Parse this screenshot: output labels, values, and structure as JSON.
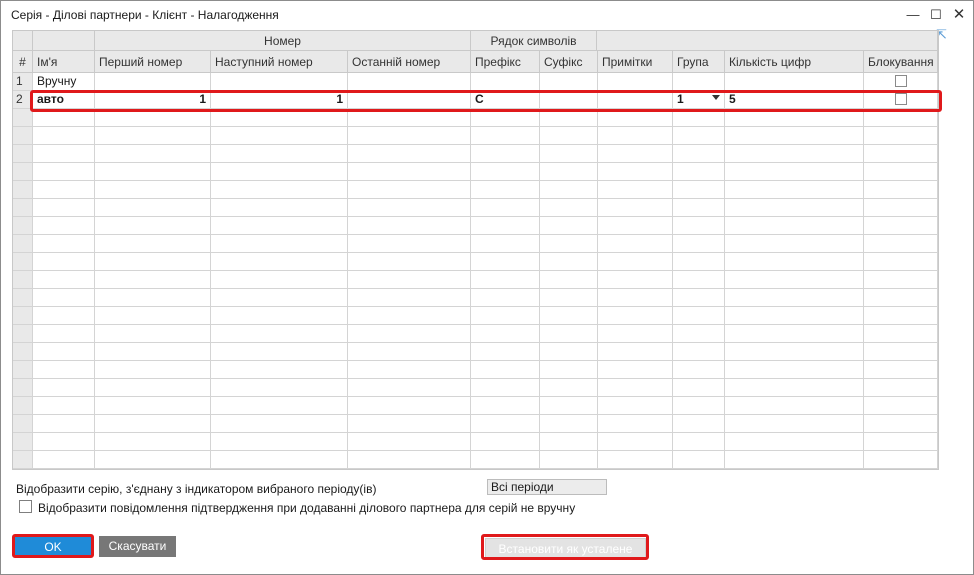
{
  "window": {
    "title": "Серія - Ділові партнери - Клієнт - Налагодження",
    "minimize": "—",
    "maximize": "☐",
    "close": "✕",
    "resize_icon": "⇱"
  },
  "grid": {
    "group_headers": {
      "number": "Номер",
      "string": "Рядок символів"
    },
    "columns": {
      "idx": "#",
      "name": "Ім'я",
      "first": "Перший номер",
      "next": "Наступний номер",
      "last": "Останній номер",
      "prefix": "Префікс",
      "suffix": "Суфікс",
      "remarks": "Примітки",
      "group": "Група",
      "digits": "Кількість цифр",
      "locked": "Блокування"
    },
    "rows": [
      {
        "idx": "1",
        "name": "Вручну",
        "first": "",
        "next": "",
        "last": "",
        "prefix": "",
        "suffix": "",
        "remarks": "",
        "group": "",
        "digits": "",
        "locked": false
      },
      {
        "idx": "2",
        "name": "авто",
        "first": "1",
        "next": "1",
        "last": "",
        "prefix": "C",
        "suffix": "",
        "remarks": "",
        "group": "1",
        "digits": "5",
        "locked": false
      }
    ]
  },
  "period": {
    "label": "Відобразити серію, з'єднану з індикатором вибраного періоду(ів)",
    "value": "Всі періоди"
  },
  "confirm": {
    "label": "Відобразити повідомлення підтвердження при додаванні ділового партнера для серій не вручну",
    "checked": false
  },
  "buttons": {
    "ok": "OK",
    "cancel": "Скасувати",
    "set_default": "Встановити як усталене"
  },
  "colors": {
    "ok_button": "#1f8bd8",
    "cancel_button": "#777777",
    "highlight": "#e0191b"
  }
}
